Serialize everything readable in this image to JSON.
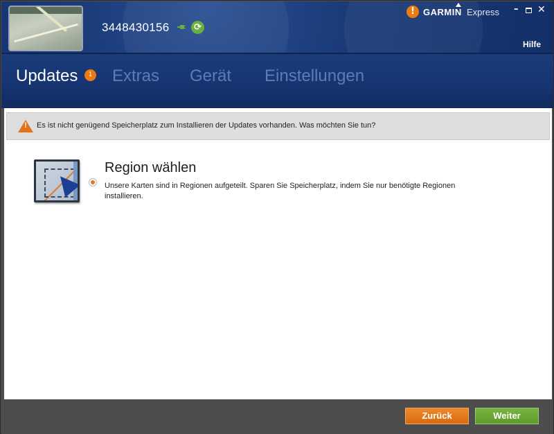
{
  "header": {
    "device_id": "3448430156",
    "brand": "GARMIN",
    "app_name": "Express",
    "help_label": "Hilfe",
    "alert_glyph": "!",
    "icons": [
      "device-thumbnail",
      "plug-icon",
      "sync-icon",
      "alert-icon",
      "minimize-icon",
      "maximize-icon",
      "close-icon"
    ]
  },
  "tabs": [
    {
      "label": "Updates",
      "active": true,
      "badge": "1"
    },
    {
      "label": "Extras",
      "active": false
    },
    {
      "label": "Gerät",
      "active": false
    },
    {
      "label": "Einstellungen",
      "active": false
    }
  ],
  "warning": {
    "text": "Es ist nicht genügend Speicherplatz zum Installieren der Updates vorhanden. Was möchten Sie tun?",
    "icon": "warning-icon"
  },
  "option": {
    "title": "Region wählen",
    "description": "Unsere Karten sind in Regionen aufgeteilt. Sparen Sie Speicherplatz, indem Sie nur benötigte Regionen installieren.",
    "selected": true
  },
  "footer": {
    "back_label": "Zurück",
    "next_label": "Weiter"
  },
  "colors": {
    "header_blue": "#132f68",
    "accent_orange": "#ea7a12",
    "accent_green": "#6cae3f",
    "inactive_tab": "#5d7bb4"
  }
}
